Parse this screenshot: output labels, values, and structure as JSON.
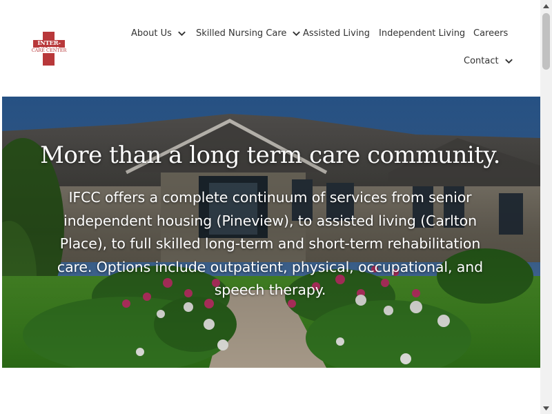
{
  "logo": {
    "line1": "INTER-FAITH",
    "line2": "CARE CENTER",
    "color": "#b8383a"
  },
  "nav": {
    "items": [
      {
        "label": "About Us",
        "has_dropdown": true
      },
      {
        "label": "Skilled Nursing Care",
        "has_dropdown": true
      },
      {
        "label": "Assisted Living",
        "has_dropdown": false
      },
      {
        "label": "Independent Living",
        "has_dropdown": false
      },
      {
        "label": "Careers",
        "has_dropdown": false
      },
      {
        "label": "Contact",
        "has_dropdown": true
      }
    ],
    "chevron_icon": "chevron-down-icon"
  },
  "hero": {
    "title": "More than a long term care community.",
    "body": "IFCC offers a complete continuum of services from senior independent housing (Pineview), to assisted living (Carlton Place), to full skilled long-term and short-term rehabilitation care. Options include outpatient, physical, occupational, and speech therapy."
  },
  "colors": {
    "text": "#333333",
    "hero_text": "#ffffff",
    "brand_red": "#b8383a"
  }
}
